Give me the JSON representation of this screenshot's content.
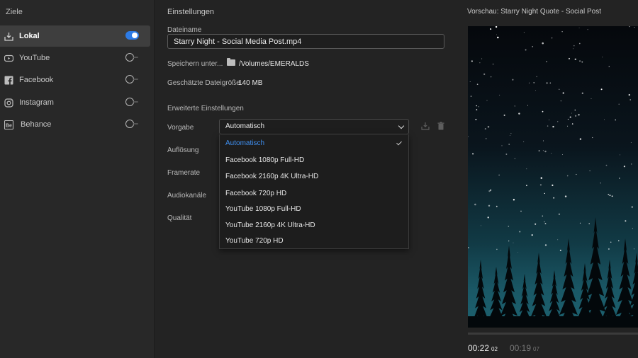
{
  "sidebar": {
    "heading": "Ziele",
    "items": [
      {
        "label": "Lokal",
        "icon": "download-icon",
        "enabled": true
      },
      {
        "label": "YouTube",
        "icon": "youtube-icon",
        "enabled": false
      },
      {
        "label": "Facebook",
        "icon": "facebook-icon",
        "enabled": false
      },
      {
        "label": "Instagram",
        "icon": "instagram-icon",
        "enabled": false
      },
      {
        "label": "Behance",
        "icon": "behance-icon",
        "enabled": false
      }
    ]
  },
  "settings": {
    "heading": "Einstellungen",
    "filename_label": "Dateiname",
    "filename_value": "Starry Night - Social Media Post.mp4",
    "save_label": "Speichern unter...",
    "save_path": "/Volumes/EMERALDS",
    "size_label": "Geschätzte Dateigröße",
    "size_value": "140 MB",
    "advanced_heading": "Erweiterte Einstellungen",
    "preset_label": "Vorgabe",
    "preset_value": "Automatisch",
    "resolution_label": "Auflösung",
    "framerate_label": "Framerate",
    "audio_label": "Audiokanäle",
    "quality_label": "Qualität",
    "preset_options": [
      "Automatisch",
      "Facebook 1080p Full-HD",
      "Facebook 2160p 4K Ultra-HD",
      "Facebook 720p HD",
      "YouTube 1080p Full-HD",
      "YouTube 2160p 4K Ultra-HD",
      "YouTube 720p HD"
    ],
    "selected_option": "Automatisch"
  },
  "preview": {
    "title": "Vorschau: Starry Night Quote - Social Post",
    "current_time": "00:22",
    "current_frames": "02",
    "duration_time": "00:19",
    "duration_frames": "07"
  },
  "colors": {
    "accent": "#2d7be5",
    "selected_text": "#3f8ff0"
  }
}
